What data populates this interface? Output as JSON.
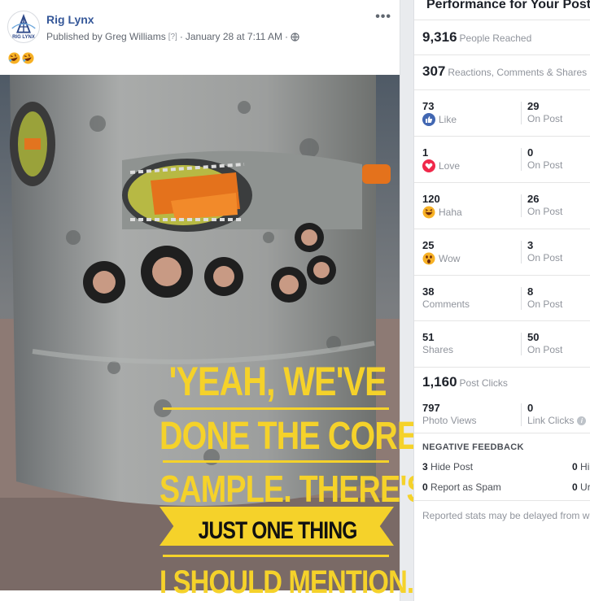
{
  "post": {
    "page_name": "Rig Lynx",
    "logo_text": "RIG LYNX",
    "published_by": "Published by Greg Williams",
    "help_marker": "[?]",
    "separator": "·",
    "date": "January 28 at 7:11 AM",
    "audience_icon": "globe-icon",
    "more_icon": "more-options-icon",
    "emoji_icon": "rofl-emoji-icon"
  },
  "image": {
    "caption_lines": [
      "'YEAH, WE'VE",
      "DONE THE CORE",
      "SAMPLE. THERE'S",
      "JUST ONE THING",
      "I SHOULD MENTION....'"
    ]
  },
  "performance": {
    "title": "Performance for Your Post",
    "people_reached": {
      "value": "9,316",
      "label": "People Reached"
    },
    "engagement": {
      "value": "307",
      "label": "Reactions, Comments & Shares"
    },
    "reactions": [
      {
        "value": "73",
        "label": "Like",
        "icon": "like-icon",
        "on_post_value": "29",
        "on_post_label": "On Post"
      },
      {
        "value": "1",
        "label": "Love",
        "icon": "love-icon",
        "on_post_value": "0",
        "on_post_label": "On Post"
      },
      {
        "value": "120",
        "label": "Haha",
        "icon": "haha-icon",
        "on_post_value": "26",
        "on_post_label": "On Post"
      },
      {
        "value": "25",
        "label": "Wow",
        "icon": "wow-icon",
        "on_post_value": "3",
        "on_post_label": "On Post"
      },
      {
        "value": "38",
        "label": "Comments",
        "on_post_value": "8",
        "on_post_label": "On Post"
      },
      {
        "value": "51",
        "label": "Shares",
        "on_post_value": "50",
        "on_post_label": "On Post"
      }
    ],
    "post_clicks": {
      "value": "1,160",
      "label": "Post Clicks"
    },
    "photo_views": {
      "value": "797",
      "label": "Photo Views"
    },
    "link_clicks": {
      "value": "0",
      "label": "Link Clicks"
    },
    "negative_feedback": {
      "title": "NEGATIVE FEEDBACK",
      "hide_post": {
        "value": "3",
        "label": "Hide Post"
      },
      "hide_all": {
        "value": "0",
        "label": "Hi"
      },
      "report_spam": {
        "value": "0",
        "label": "Report as Spam"
      },
      "unlike": {
        "value": "0",
        "label": "Ur"
      }
    },
    "note": "Reported stats may be delayed from wh"
  },
  "colors": {
    "link_blue": "#365899",
    "caption_yellow": "#f5d22a",
    "like_blue": "#4267b2",
    "love_red": "#f0284a",
    "haha_yellow": "#f7b125"
  }
}
